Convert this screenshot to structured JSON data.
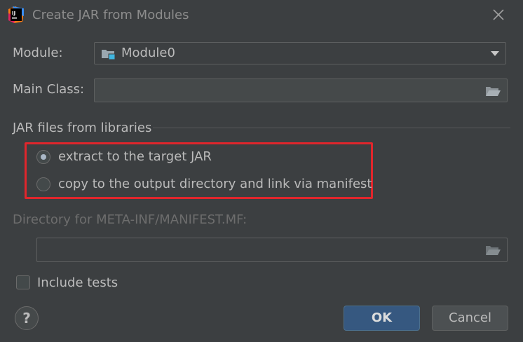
{
  "dialog": {
    "title": "Create JAR from Modules"
  },
  "module": {
    "label": "Module:",
    "value": "Module0"
  },
  "main_class": {
    "label": "Main Class:",
    "value": ""
  },
  "libraries": {
    "section_label": "JAR files from libraries",
    "options": [
      {
        "label": "extract to the target JAR",
        "selected": true
      },
      {
        "label": "copy to the output directory and link via manifest",
        "selected": false
      }
    ]
  },
  "manifest": {
    "label": "Directory for META-INF/MANIFEST.MF:",
    "value": ""
  },
  "include_tests": {
    "label": "Include tests",
    "checked": false
  },
  "buttons": {
    "help": "?",
    "ok": "OK",
    "cancel": "Cancel"
  },
  "colors": {
    "background": "#3c3f41",
    "highlight_box": "#e0262c",
    "ok_button": "#365880"
  }
}
